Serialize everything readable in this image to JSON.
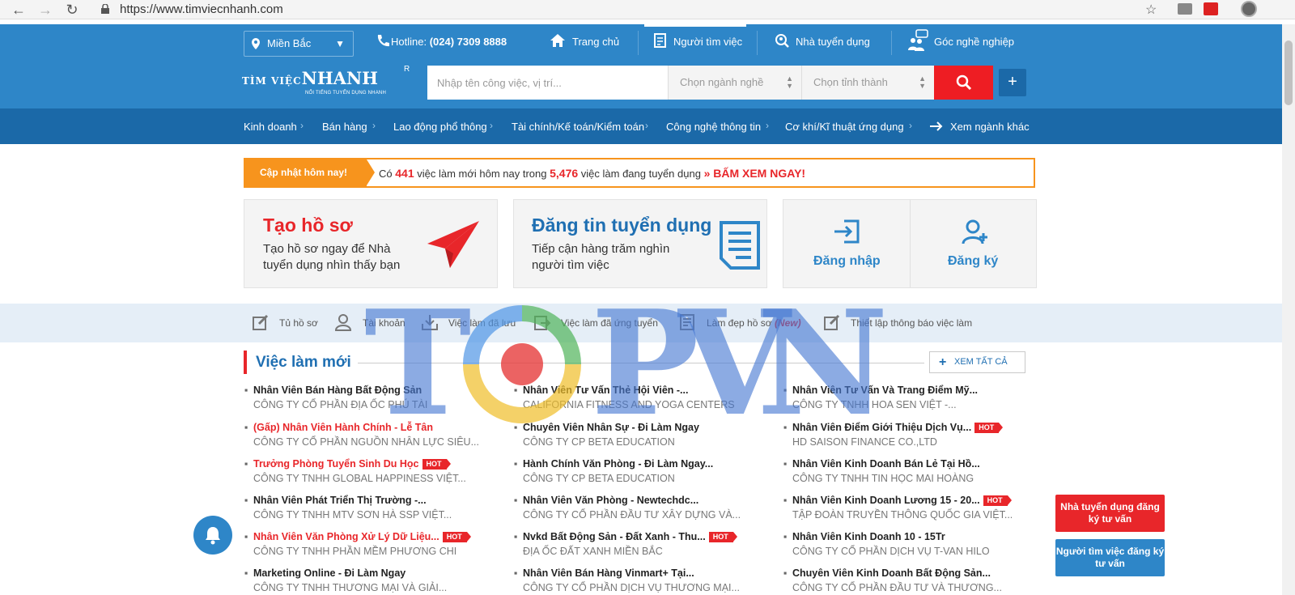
{
  "browser": {
    "url": "https://www.timviecnhanh.com",
    "back_icon": "arrow-left-icon",
    "forward_icon": "arrow-right-icon",
    "reload_icon": "reload-icon"
  },
  "header": {
    "region": "Miền Bắc",
    "hotline_label": "Hotline:",
    "hotline_number": "(024) 7309 8888",
    "nav": [
      {
        "label": "Trang chủ",
        "icon": "home-icon"
      },
      {
        "label": "Người tìm việc",
        "icon": "resume-icon"
      },
      {
        "label": "Nhà tuyển dụng",
        "icon": "search-person-icon"
      },
      {
        "label": "Góc nghề nghiệp",
        "icon": "group-icon"
      }
    ],
    "logo_main_1": "TÌM VIỆC",
    "logo_main_2": "NHANH",
    "logo_tagline": "NỔI TIẾNG TUYỂN DỤNG NHANH",
    "logo_reg": "R"
  },
  "search": {
    "placeholder": "Nhập tên công việc, vị trí...",
    "industry_select": "Chọn ngành nghề",
    "city_select": "Chọn tỉnh thành",
    "plus_label": "+"
  },
  "categories": [
    "Kinh doanh",
    "Bán hàng",
    "Lao động phổ thông",
    "Tài chính/Kế toán/Kiểm toán",
    "Công nghệ thông tin",
    "Cơ khí/Kĩ thuật ứng dụng"
  ],
  "more_categories": "Xem ngành khác",
  "update": {
    "label": "Cập nhật hôm nay!",
    "text_1": "Có",
    "new_jobs": "441",
    "text_2": "việc làm mới hôm nay trong",
    "total_jobs": "5,476",
    "text_3": "việc làm đang tuyển dụng",
    "cta": "»  BẤM XEM NGAY!"
  },
  "cards": {
    "profile_title": "Tạo hồ sơ",
    "profile_desc": "Tạo hồ sơ ngay để Nhà tuyển dụng nhìn thấy bạn",
    "post_title": "Đăng tin tuyển dụng",
    "post_desc": "Tiếp cận hàng trăm nghìn người tìm việc",
    "login": "Đăng nhập",
    "register": "Đăng ký"
  },
  "toolbar": [
    {
      "label": "Tủ hồ sơ",
      "icon": "edit-icon"
    },
    {
      "label": "Tài khoản",
      "icon": "user-icon"
    },
    {
      "label": "Việc làm đã lưu",
      "icon": "download-icon"
    },
    {
      "label": "Việc làm đã ứng tuyển",
      "icon": "share-icon"
    },
    {
      "label": "Làm đẹp hồ sơ",
      "icon": "document-icon"
    },
    {
      "label": "Thiết lập thông báo việc làm",
      "icon": "edit-icon"
    }
  ],
  "toolbar_new": "(New)",
  "section": {
    "title": "Việc làm mới",
    "see_all": "XEM TẤT CẢ"
  },
  "hot_label": "HOT",
  "jobs": [
    {
      "title": "Nhân Viên Bán Hàng Bất Động Sản",
      "company": "CÔNG TY CỔ PHẦN ĐỊA ỐC PHÚ TÀI"
    },
    {
      "title": "Nhân Viên Tư Vấn Thẻ Hội Viên -...",
      "company": "CALIFORNIA FITNESS AND YOGA CENTERS"
    },
    {
      "title": "Nhân Viên Tư Vấn Và Trang Điểm Mỹ...",
      "company": "CÔNG TY TNHH HOA SEN VIỆT -..."
    },
    {
      "title": "(Gấp) Nhân Viên Hành Chính - Lễ Tân",
      "company": "CÔNG TY CỔ PHẦN NGUỒN NHÂN LỰC SIÊU..."
    },
    {
      "title": "Chuyên Viên Nhân Sự - Đi Làm Ngay",
      "company": "CÔNG TY CP BETA EDUCATION"
    },
    {
      "title": "Nhân Viên Điểm Giới Thiệu Dịch Vụ...",
      "company": "HD SAISON FINANCE CO.,LTD"
    },
    {
      "title": "Trưởng Phòng Tuyển Sinh Du Học",
      "company": "CÔNG TY TNHH GLOBAL HAPPINESS VIỆT..."
    },
    {
      "title": "Hành Chính Văn Phòng - Đi Làm Ngay...",
      "company": "CÔNG TY CP BETA EDUCATION"
    },
    {
      "title": "Nhân Viên Kinh Doanh Bán Lẻ Tại Hồ...",
      "company": "CÔNG TY TNHH TIN HỌC MAI HOÀNG"
    },
    {
      "title": "Nhân Viên Phát Triển Thị Trường -...",
      "company": "CÔNG TY TNHH MTV SƠN HÀ SSP VIỆT..."
    },
    {
      "title": "Nhân Viên Văn Phòng - Newtechdc...",
      "company": "CÔNG TY CỔ PHẦN ĐẦU TƯ XÂY DỰNG VÀ..."
    },
    {
      "title": "Nhân Viên Kinh Doanh Lương 15 - 20...",
      "company": "TẬP ĐOÀN TRUYỀN THÔNG QUỐC GIA VIỆT..."
    },
    {
      "title": "Nhân Viên Văn Phòng Xử Lý Dữ Liệu...",
      "company": "CÔNG TY TNHH PHẦN MỀM PHƯƠNG CHI"
    },
    {
      "title": "Nvkd Bất Động Sản - Đất Xanh - Thu...",
      "company": "ĐỊA ỐC ĐẤT XANH MIỀN BẮC"
    },
    {
      "title": "Nhân Viên Kinh Doanh 10 - 15Tr",
      "company": "CÔNG TY CỔ PHẦN DỊCH VỤ T-VAN HILO"
    },
    {
      "title": "Marketing Online - Đi Làm Ngay",
      "company": "CÔNG TY TNHH THƯƠNG MẠI VÀ GIẢI..."
    },
    {
      "title": "Nhân Viên Bán Hàng Vinmart+ Tại...",
      "company": "CÔNG TY CỔ PHẦN DỊCH VỤ THƯƠNG MẠI..."
    },
    {
      "title": "Chuyên Viên Kinh Doanh Bất Động Sản...",
      "company": "CÔNG TY CỔ PHẦN ĐẦU TƯ VÀ THƯƠNG..."
    }
  ],
  "float": {
    "employer": "Nhà tuyển dụng đăng ký tư vấn",
    "seeker": "Người tìm việc đăng ký tư vấn"
  },
  "watermark": {
    "letters": [
      "T",
      "P",
      "V",
      "N"
    ]
  },
  "colors": {
    "primary": "#2e86c8",
    "dark": "#1b69a8",
    "accent": "#ee1d23",
    "orange": "#f7941d"
  }
}
